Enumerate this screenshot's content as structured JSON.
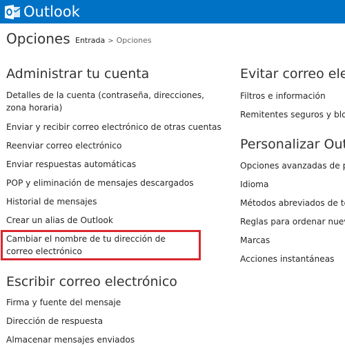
{
  "header": {
    "brand": "Outlook",
    "bg_color": "#0072c6",
    "logo_icon": "outlook-logo-icon"
  },
  "page": {
    "title": "Opciones",
    "breadcrumb": {
      "home": "Entrada",
      "separator": ">",
      "current": "Opciones"
    }
  },
  "left_column": {
    "account": {
      "heading": "Administrar tu cuenta",
      "items": [
        "Detalles de la cuenta (contraseña, direcciones, zona horaria)",
        "Enviar y recibir correo electrónico de otras cuentas",
        "Reenviar correo electrónico",
        "Enviar respuestas automáticas",
        "POP y eliminación de mensajes descargados",
        "Historial de mensajes",
        "Crear un alias de Outlook",
        "Cambiar el nombre de tu dirección de correo electrónico"
      ]
    },
    "write": {
      "heading": "Escribir correo electrónico",
      "items": [
        "Firma y fuente del mensaje",
        "Dirección de respuesta",
        "Almacenar mensajes enviados"
      ]
    }
  },
  "right_column": {
    "junk": {
      "heading": "Evitar correo elect",
      "items": [
        "Filtros e información",
        "Remitentes seguros y bloc"
      ]
    },
    "customize": {
      "heading": "Personalizar Outlo",
      "items": [
        "Opciones avanzadas de pr",
        "Idioma",
        "Métodos abreviados de te",
        "Reglas para ordenar nueve",
        "Marcas",
        "Acciones instantáneas"
      ]
    }
  },
  "highlight_color": "#d9262c"
}
